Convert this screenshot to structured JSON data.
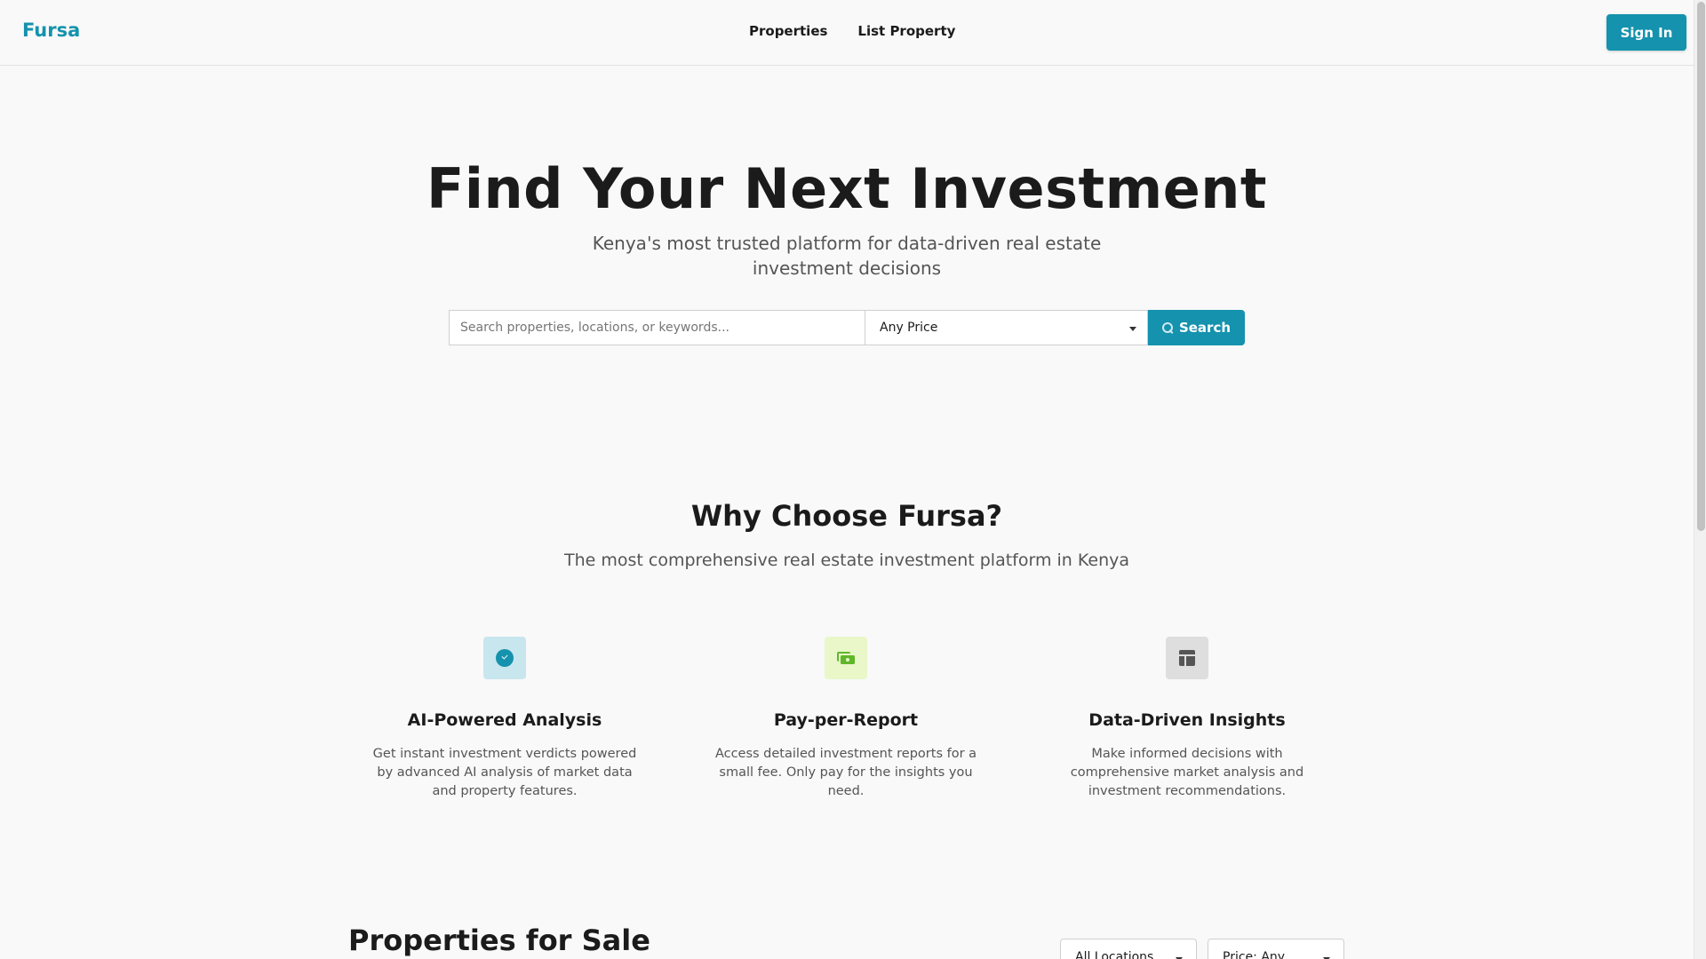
{
  "header": {
    "logo": "Fursa",
    "nav": [
      {
        "label": "Properties"
      },
      {
        "label": "List Property"
      }
    ],
    "signin_label": "Sign In"
  },
  "hero": {
    "title": "Find Your Next Investment",
    "subtitle": "Kenya's most trusted platform for data-driven real estate investment decisions",
    "search": {
      "placeholder": "Search properties, locations, or keywords...",
      "value": "",
      "price_selected": "Any Price",
      "button_label": "Search",
      "button_icon": "search-icon"
    }
  },
  "why": {
    "title": "Why Choose Fursa?",
    "subtitle": "The most comprehensive real estate investment platform in Kenya",
    "features": [
      {
        "title": "AI-Powered Analysis",
        "text": "Get instant investment verdicts powered by advanced AI analysis of market data and property features.",
        "icon": "check-circle-icon",
        "icon_bg": "#c8e6ee"
      },
      {
        "title": "Pay-per-Report",
        "text": "Access detailed investment reports for a small fee. Only pay for the insights you need.",
        "icon": "money-icon",
        "icon_bg": "#e9f7c9"
      },
      {
        "title": "Data-Driven Insights",
        "text": "Make informed decisions with comprehensive market analysis and investment recommendations.",
        "icon": "layout-icon",
        "icon_bg": "#dedede"
      }
    ]
  },
  "properties": {
    "title": "Properties for Sale",
    "location_filter": "All Locations",
    "price_filter": "Price: Any"
  },
  "colors": {
    "accent": "#1592ad",
    "background": "#f9f9f9"
  }
}
